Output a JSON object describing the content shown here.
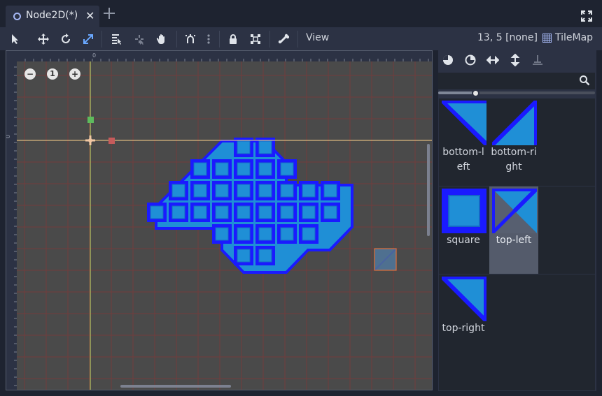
{
  "tab": {
    "title": "Node2D(*)",
    "close_glyph": "✕",
    "add_glyph": "+",
    "icons": {
      "node": "node2d-icon",
      "add": "plus-icon",
      "fullscreen": "fullscreen-icon"
    }
  },
  "toolbar": {
    "tools": [
      "select-icon",
      "move-icon",
      "rotate-icon",
      "scale-icon",
      "list-select-icon",
      "pivot-icon",
      "pan-icon",
      "snap-icon",
      "more-icon",
      "lock-icon",
      "group-icon",
      "bone-icon"
    ],
    "view_label": "View",
    "coords": "13, 5 [none]",
    "tilemap_label": "TileMap"
  },
  "viewport": {
    "zoom_out": "−",
    "zoom_reset": "1",
    "zoom_in": "+",
    "ruler_top_zero": "0",
    "ruler_left_zero": "0",
    "colors": {
      "background": "#4a4a4a",
      "grid": "#8a3c3c",
      "tile_fill": "#1f8fd6",
      "tile_border": "#1a1aff",
      "axis_x": "#ffd38a",
      "axis_y": "#c9e06a"
    }
  },
  "panel": {
    "tools": [
      "rotate-left-icon",
      "rotate-right-icon",
      "flip-horizontal-icon",
      "flip-vertical-icon",
      "clear-transform-icon"
    ],
    "search_placeholder": "",
    "zoom_level": 0.22,
    "tiles": [
      {
        "name": "bottom-left",
        "label_line1": "bottom-l",
        "label_line2": "eft",
        "selected": false
      },
      {
        "name": "bottom-right",
        "label_line1": "bottom-ri",
        "label_line2": "ght",
        "selected": false
      },
      {
        "name": "square",
        "label_line1": "square",
        "label_line2": "",
        "selected": false
      },
      {
        "name": "top-left",
        "label_line1": "top-left",
        "label_line2": "",
        "selected": true
      },
      {
        "name": "top-right",
        "label_line1": "top-right",
        "label_line2": "",
        "selected": false
      }
    ]
  }
}
